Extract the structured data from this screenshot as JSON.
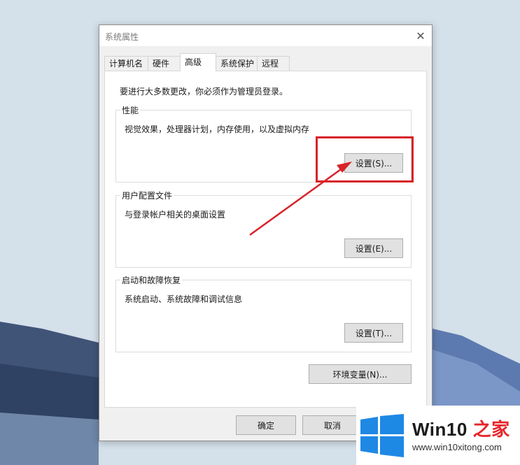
{
  "dialog": {
    "title": "系统属性",
    "close_glyph": "✕"
  },
  "tabs": [
    {
      "label": "计算机名"
    },
    {
      "label": "硬件"
    },
    {
      "label": "高级"
    },
    {
      "label": "系统保护"
    },
    {
      "label": "远程"
    }
  ],
  "active_tab": "高级",
  "admin_note": "要进行大多数更改，你必须作为管理员登录。",
  "groups": {
    "performance": {
      "title": "性能",
      "description": "视觉效果，处理器计划，内存使用，以及虚拟内存",
      "button": "设置(S)..."
    },
    "user_profiles": {
      "title": "用户配置文件",
      "description": "与登录帐户相关的桌面设置",
      "button": "设置(E)..."
    },
    "startup_recovery": {
      "title": "启动和故障恢复",
      "description": "系统启动、系统故障和调试信息",
      "button": "设置(T)..."
    }
  },
  "env_button": "环境变量(N)...",
  "footer": {
    "ok": "确定",
    "cancel": "取消"
  },
  "annotation": {
    "color": "#d8232a"
  },
  "watermark": {
    "brand_prefix": "Win10",
    "brand_suffix": " 之家",
    "url": "www.win10xitong.com"
  }
}
